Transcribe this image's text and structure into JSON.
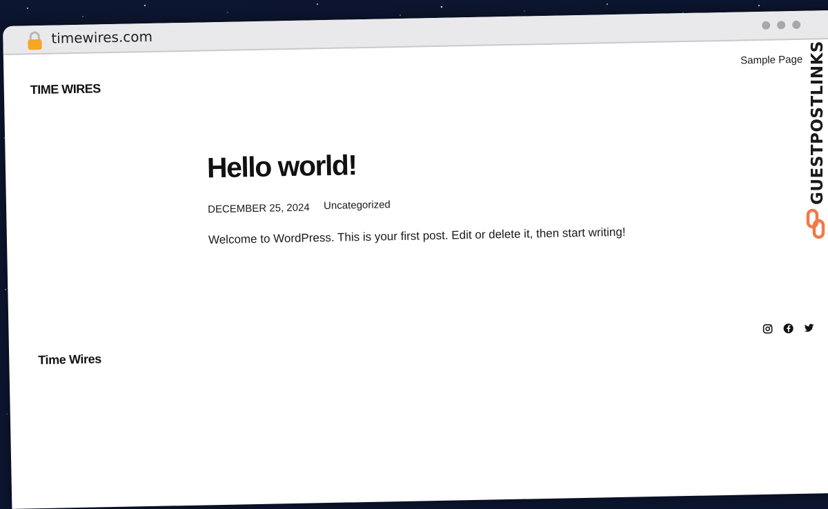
{
  "browser": {
    "url": "timewires.com",
    "lock_icon": "lock-icon",
    "window_controls": [
      "dot",
      "dot",
      "dot"
    ]
  },
  "header": {
    "site_title": "TIME WIRES",
    "nav": {
      "sample_page": "Sample Page"
    }
  },
  "post": {
    "title": "Hello world!",
    "date": "DECEMBER 25, 2024",
    "category": "Uncategorized",
    "excerpt": "Welcome to WordPress. This is your first post. Edit or delete it, then start writing!"
  },
  "footer": {
    "site_title": "Time Wires",
    "social_icons": [
      "instagram-icon",
      "facebook-icon",
      "twitter-icon"
    ]
  },
  "watermark": {
    "text": "GUESTPOSTLINKS",
    "accent_color": "#f07a4a"
  },
  "colors": {
    "background": "#0d1630",
    "titlebar": "#e9e9ec",
    "lock": "#f5a623",
    "text": "#111111"
  }
}
